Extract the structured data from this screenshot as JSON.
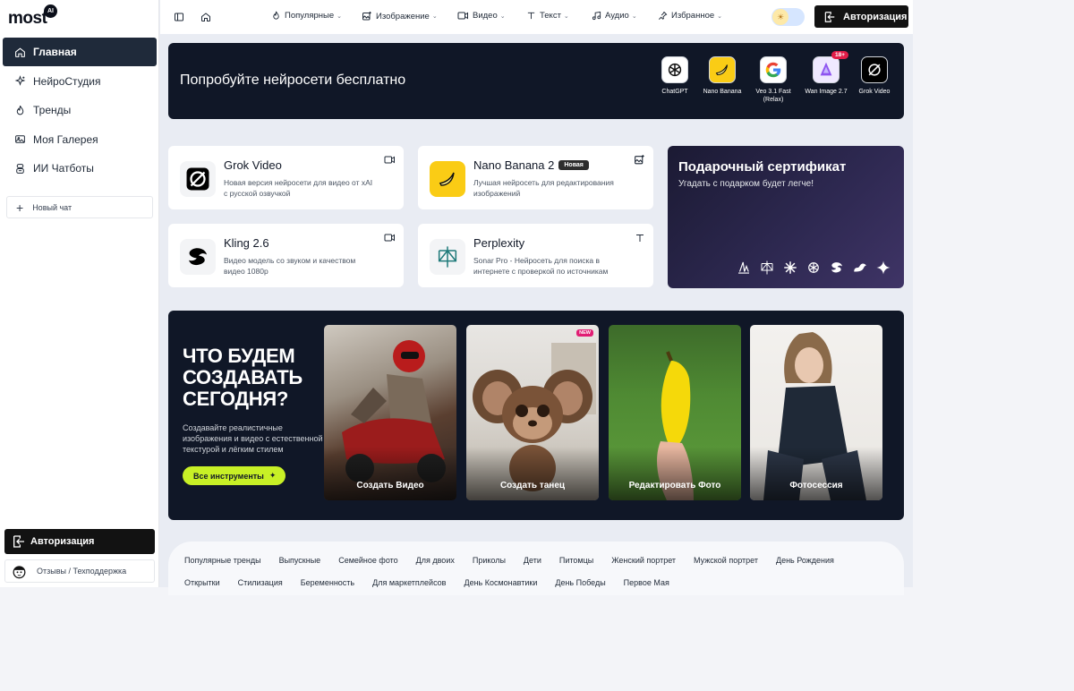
{
  "logo": {
    "text": "most",
    "badge": "AI"
  },
  "sidebar": {
    "items": [
      {
        "label": "Главная",
        "icon": "home-icon",
        "active": true
      },
      {
        "label": "НейроСтудия",
        "icon": "sparkle-icon"
      },
      {
        "label": "Тренды",
        "icon": "flame-icon"
      },
      {
        "label": "Моя Галерея",
        "icon": "gallery-icon"
      },
      {
        "label": "ИИ Чатботы",
        "icon": "robot-icon"
      }
    ],
    "new_chat": "Новый чат",
    "auth": "Авторизация",
    "support": "Отзывы / Техподдержка"
  },
  "topbar": {
    "menus": [
      {
        "label": "Популярные",
        "icon": "flame-icon"
      },
      {
        "label": "Изображение",
        "icon": "image-edit-icon"
      },
      {
        "label": "Видео",
        "icon": "video-icon"
      },
      {
        "label": "Текст",
        "icon": "text-icon"
      },
      {
        "label": "Аудио",
        "icon": "music-icon"
      },
      {
        "label": "Избранное",
        "icon": "pin-icon"
      }
    ],
    "auth": "Авторизация"
  },
  "hero": {
    "title": "Попробуйте нейросети бесплатно",
    "models": [
      {
        "name": "ChatGPT",
        "icon": "chatgpt-icon"
      },
      {
        "name": "Nano Banana",
        "icon": "banana-icon"
      },
      {
        "name": "Veo 3.1 Fast (Relax)",
        "icon": "google-icon"
      },
      {
        "name": "Wan Image 2.7",
        "icon": "wan-icon",
        "badge": "18+"
      },
      {
        "name": "Grok Video",
        "icon": "grok-icon"
      }
    ]
  },
  "cards": [
    {
      "title": "Grok Video",
      "desc": "Новая версия нейросети для видео от xAI с русской озвучкой",
      "type_icon": "video-icon"
    },
    {
      "title": "Nano Banana 2",
      "badge": "Новая",
      "desc": "Лучшая нейросеть для редактирования изображений",
      "type_icon": "image-edit-icon"
    },
    {
      "title": "Kling 2.6",
      "desc": "Видео модель со звуком и качеством видео 1080p",
      "type_icon": "video-icon"
    },
    {
      "title": "Perplexity",
      "desc": "Sonar Pro - Нейросеть для поиска в интернете с проверкой по источникам",
      "type_icon": "text-icon"
    }
  ],
  "gift": {
    "title": "Подарочный сертификат",
    "subtitle": "Угадать с подарком будет легче!"
  },
  "create": {
    "title": "ЧТО БУДЕМ СОЗДАВАТЬ СЕГОДНЯ?",
    "desc": "Создавайте реалистичные изображения и видео с естественной текстурой и лёгким стилем",
    "button": "Все инструменты",
    "tiles": [
      {
        "label": "Создать Видео"
      },
      {
        "label": "Создать танец",
        "badge": "NEW"
      },
      {
        "label": "Редактировать Фото"
      },
      {
        "label": "Фотосессия"
      }
    ]
  },
  "tags": {
    "row1": [
      "Популярные тренды",
      "Выпускные",
      "Семейное фото",
      "Для двоих",
      "Приколы",
      "Дети",
      "Питомцы",
      "Женский портрет",
      "Мужской портрет",
      "День Рождения"
    ],
    "row2": [
      "Открытки",
      "Стилизация",
      "Беременность",
      "Для маркетплейсов",
      "День Космонавтики",
      "День Победы",
      "Первое Мая"
    ]
  },
  "colors": {
    "accent_lime": "#c8f026",
    "dark_navy": "#101727",
    "active_nav": "#1f2a3a"
  }
}
